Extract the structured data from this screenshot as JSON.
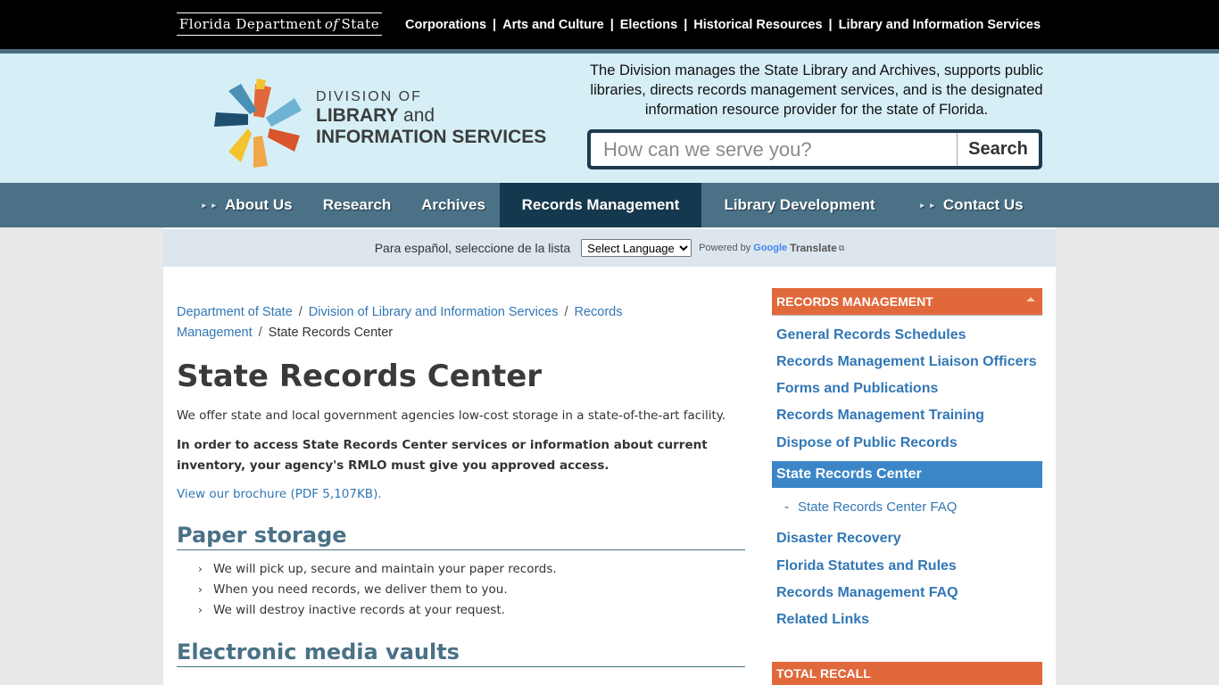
{
  "topbar": {
    "logo": {
      "part1": "Florida Department",
      "of": "of",
      "part2": "State"
    },
    "links": [
      "Corporations",
      "Arts and Culture",
      "Elections",
      "Historical Resources",
      "Library and Information Services"
    ],
    "separator": "|"
  },
  "header": {
    "brand": {
      "line1": "DIVISION OF",
      "line2": "LIBRARY",
      "line2_and": "and",
      "line3": "INFORMATION SERVICES"
    },
    "mission": "The Division manages the State Library and Archives, supports public libraries, directs records management services, and is the designated information resource provider for the state of Florida.",
    "search": {
      "placeholder": "How can we serve you?",
      "button": "Search"
    }
  },
  "nav": {
    "items": [
      "About Us",
      "Research",
      "Archives",
      "Records Management",
      "Library Development",
      "Contact Us"
    ],
    "active": "Records Management",
    "caret": "▸ ▸"
  },
  "translate": {
    "label": "Para español, seleccione de la lista",
    "select": "Select Language",
    "powered": "Powered by",
    "google": "Google",
    "translate": "Translate",
    "ext": "⧉"
  },
  "breadcrumb": {
    "items": [
      "Department of State",
      "Division of Library and Information Services",
      "Records Management"
    ],
    "current": "State Records Center",
    "sep": "/"
  },
  "main": {
    "title": "State Records Center",
    "intro": "We offer state and local government agencies low-cost storage in a state-of-the-art facility.",
    "notice": "In order to access State Records Center services or information about current inventory, your agency's RMLO must give you approved access.",
    "brochure": "View our brochure (PDF 5,107KB).",
    "sections": [
      {
        "heading": "Paper storage",
        "bullets": [
          "We will pick up, secure and maintain your paper records.",
          "When you need records, we deliver them to you.",
          "We will destroy inactive records at your request."
        ]
      },
      {
        "heading": "Electronic media vaults",
        "bullets": []
      }
    ]
  },
  "sidebar": {
    "heading": "RECORDS MANAGEMENT",
    "links_top": [
      "General Records Schedules",
      "Records Management Liaison Officers",
      "Forms and Publications",
      "Records Management Training",
      "Dispose of Public Records"
    ],
    "active": "State Records Center",
    "sub": {
      "dash": "-",
      "label": "State Records Center FAQ"
    },
    "links_bottom": [
      "Disaster Recovery",
      "Florida Statutes and Rules",
      "Records Management FAQ",
      "Related Links"
    ],
    "heading2": "TOTAL RECALL"
  },
  "colors": {
    "topbar": "#000000",
    "header": "#d6eff7",
    "nav": "#4a7186",
    "nav_active": "#14384e",
    "sidebar_head": "#e0683a",
    "sidebar_active": "#3a86c8",
    "link": "#3277b5"
  }
}
